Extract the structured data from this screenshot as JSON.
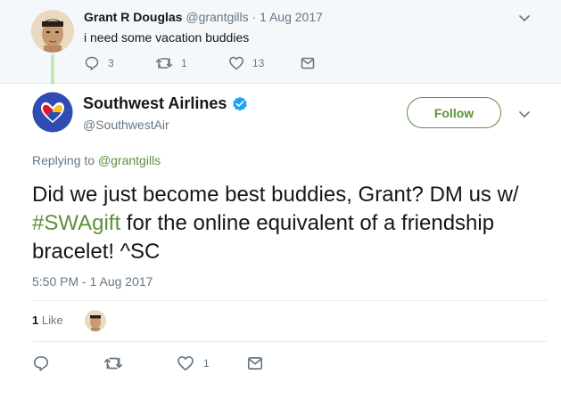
{
  "parent_tweet": {
    "display_name": "Grant R Douglas",
    "handle": "@grantgills",
    "separator": "·",
    "date": "1 Aug 2017",
    "text": "i need some vacation buddies",
    "replies": "3",
    "retweets": "1",
    "likes": "13"
  },
  "main_tweet": {
    "display_name": "Southwest Airlines",
    "handle": "@SouthwestAir",
    "follow_label": "Follow",
    "replying_prefix": "Replying to",
    "replying_to": "@grantgills",
    "text_before": "Did we just become best buddies, Grant? DM us w/ ",
    "hashtag": "#SWAgift",
    "text_after": " for the online equivalent of a friendship bracelet! ^SC",
    "timestamp": "5:50 PM - 1 Aug 2017",
    "like_count": "1",
    "like_label": "Like",
    "likes": "1"
  },
  "icons": {
    "reply": "reply-icon",
    "retweet": "retweet-icon",
    "like": "heart-icon",
    "message": "envelope-icon",
    "verified": "verified-badge-icon",
    "more": "chevron-down-icon"
  },
  "colors": {
    "accent": "#5c913b",
    "muted": "#657786",
    "verified": "#1da1f2",
    "thread": "#c4e6b8"
  }
}
